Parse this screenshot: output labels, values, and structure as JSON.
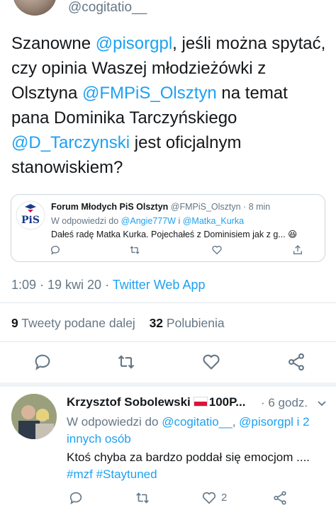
{
  "header": {
    "handle": "@cogitatio__"
  },
  "tweet": {
    "text_parts": {
      "p1": "Szanowne ",
      "m1": "@pisorgpl",
      "p2": ", jeśli można spytać, czy opinia Waszej młodzieżówki z Olsztyna ",
      "m2": "@FMPiS_Olsztyn",
      "p3": " na temat pana Dominika Tarczyńskiego ",
      "m3": "@D_Tarczynski",
      "p4": " jest oficjalnym stanowiskiem?"
    },
    "time": "1:09 · 19 kwi 20 · ",
    "client": "Twitter Web App",
    "retweets_count": "9",
    "retweets_label": " Tweety podane dalej",
    "likes_count": "32",
    "likes_label": " Polubienia"
  },
  "quote": {
    "name": "Forum Młodych PiS Olsztyn",
    "handle_time": " @FMPiS_Olsztyn · 8 min",
    "reply_prefix": "W odpowiedzi do ",
    "reply_user1": "@Angie777W",
    "reply_and": " i ",
    "reply_user2": "@Matka_Kurka",
    "text": "Dałeś radę Matka Kurka. Pojechałeś z Dominisiem jak z g... 😆",
    "logo_text": "PiS"
  },
  "reply": {
    "name": "Krzysztof Sobolewski",
    "name_suffix": "100P...",
    "time": "· 6 godz.",
    "reply_prefix": "W odpowiedzi do ",
    "reply_user1": "@cogitatio__",
    "reply_sep": ", ",
    "reply_user2": "@pisorgpl",
    "reply_others": " i 2 innych osób",
    "text": "Ktoś chyba za bardzo poddał się emocjom ....",
    "hashtag1": "#mzf",
    "hashtag2": "#Staytuned",
    "likes": "2"
  },
  "colors": {
    "accent": "#1da1f2",
    "muted": "#657786",
    "text": "#14171a",
    "border": "#ccd6dd"
  },
  "icons": [
    "reply-icon",
    "retweet-icon",
    "like-icon",
    "share-icon",
    "chevron-down-icon"
  ]
}
